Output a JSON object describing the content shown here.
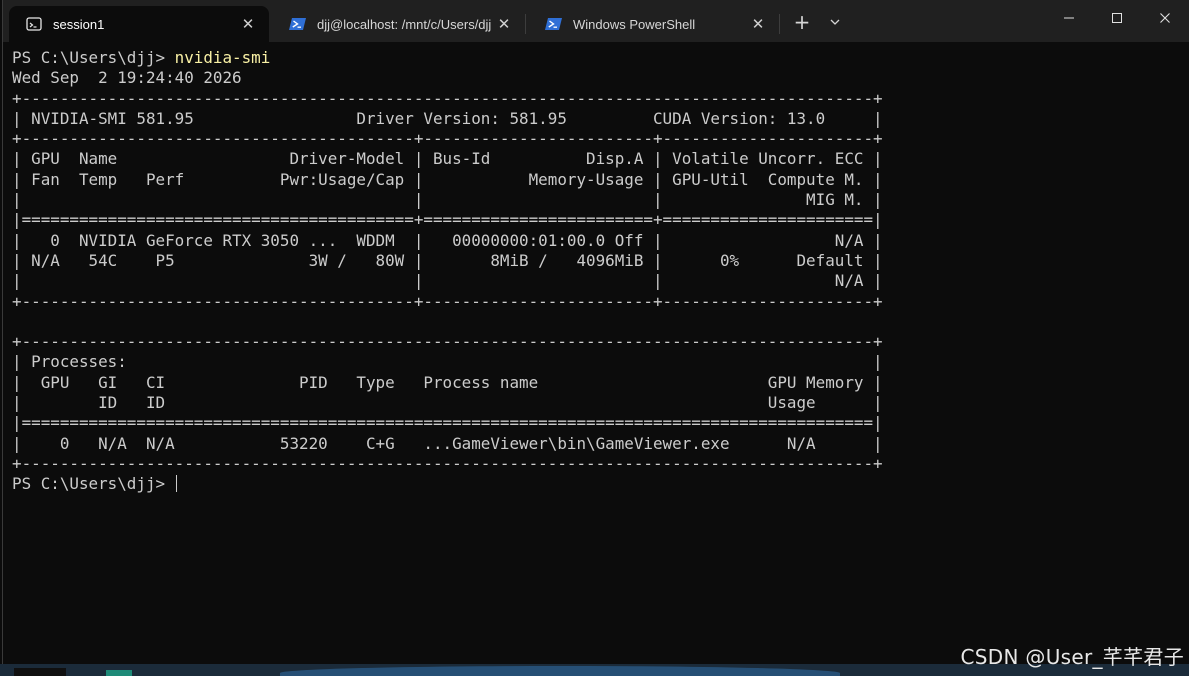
{
  "tabs": [
    {
      "label": "session1",
      "icon": "terminal-window-icon",
      "active": true
    },
    {
      "label": "djj@localhost: /mnt/c/Users/djj",
      "icon": "powershell-icon",
      "active": false
    },
    {
      "label": "Windows PowerShell",
      "icon": "powershell-icon",
      "active": false
    }
  ],
  "toolbar": {
    "new_tab": "+",
    "dropdown": "⌄"
  },
  "window_controls": {
    "minimize": "—",
    "maximize": "☐",
    "close": "✕"
  },
  "terminal": {
    "prompt": "PS C:\\Users\\djj> ",
    "command": "nvidia-smi",
    "lines": [
      "Wed Sep  2 19:24:40 2026",
      "+-----------------------------------------------------------------------------------------+",
      "| NVIDIA-SMI 581.95                 Driver Version: 581.95         CUDA Version: 13.0     |",
      "+-----------------------------------------+------------------------+----------------------+",
      "| GPU  Name                  Driver-Model | Bus-Id          Disp.A | Volatile Uncorr. ECC |",
      "| Fan  Temp   Perf          Pwr:Usage/Cap |           Memory-Usage | GPU-Util  Compute M. |",
      "|                                         |                        |               MIG M. |",
      "|=========================================+========================+======================|",
      "|   0  NVIDIA GeForce RTX 3050 ...  WDDM  |   00000000:01:00.0 Off |                  N/A |",
      "| N/A   54C    P5              3W /   80W |       8MiB /   4096MiB |      0%      Default |",
      "|                                         |                        |                  N/A |",
      "+-----------------------------------------+------------------------+----------------------+",
      "",
      "+-----------------------------------------------------------------------------------------+",
      "| Processes:                                                                              |",
      "|  GPU   GI   CI              PID   Type   Process name                        GPU Memory |",
      "|        ID   ID                                                               Usage      |",
      "|=========================================================================================|",
      "|    0   N/A  N/A           53220    C+G   ...GameViewer\\bin\\GameViewer.exe      N/A      |",
      "+-----------------------------------------------------------------------------------------+"
    ],
    "final_prompt": "PS C:\\Users\\djj> "
  },
  "watermark": "CSDN @User_芊芊君子"
}
